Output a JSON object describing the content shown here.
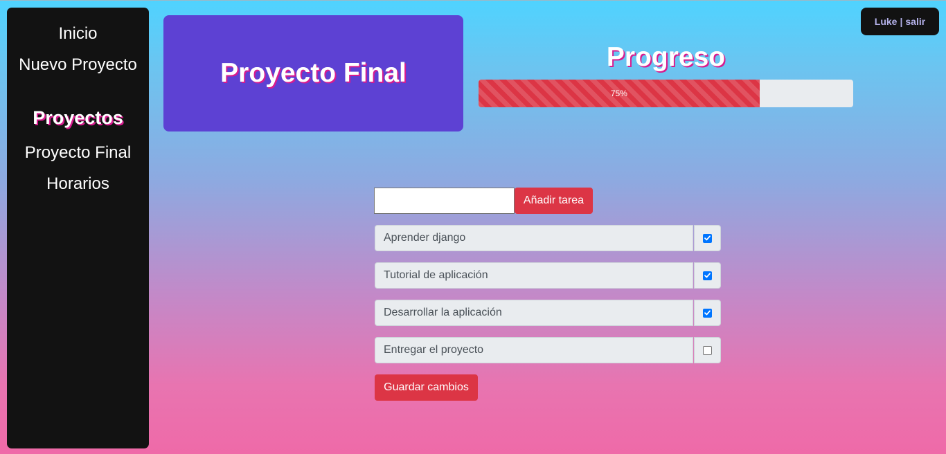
{
  "sidebar": {
    "links": [
      {
        "label": "Inicio"
      },
      {
        "label": "Nuevo Proyecto"
      }
    ],
    "projects_heading": "Proyectos",
    "projects": [
      {
        "label": "Proyecto Final"
      },
      {
        "label": "Horarios"
      }
    ]
  },
  "project": {
    "title": "Proyecto Final"
  },
  "progress": {
    "title": "Progreso",
    "value_percent": 75,
    "label": "75%",
    "color": "#dc3545"
  },
  "user": {
    "name": "Luke",
    "separator": "|",
    "logout_label": "salir"
  },
  "task_form": {
    "input_value": "",
    "input_placeholder": "",
    "add_button_label": "Añadir tarea"
  },
  "tasks": [
    {
      "label": "Aprender django",
      "done": true
    },
    {
      "label": "Tutorial de aplicación",
      "done": true
    },
    {
      "label": "Desarrollar la aplicación",
      "done": true
    },
    {
      "label": "Entregar el proyecto",
      "done": false
    }
  ],
  "save_button_label": "Guardar cambios",
  "colors": {
    "sidebar_bg": "#121212",
    "title_card_bg": "#5d41d3",
    "accent_red": "#dc3545",
    "checkbox_blue": "#0075ff",
    "heading_shadow": "#d81b8f"
  }
}
